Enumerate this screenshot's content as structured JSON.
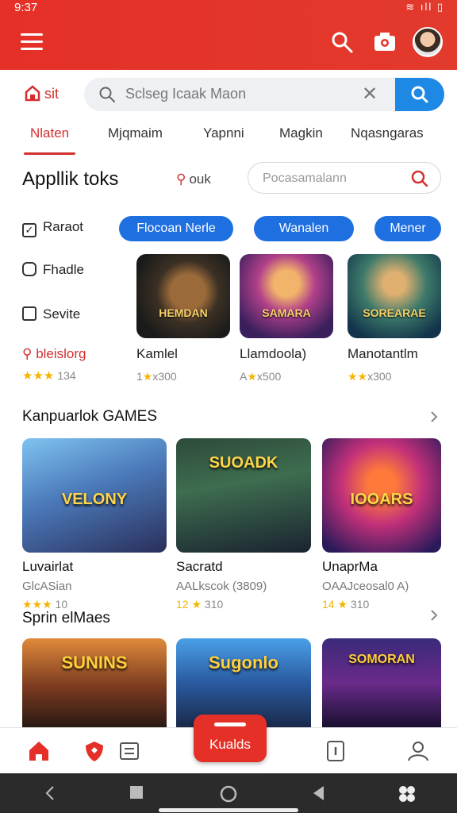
{
  "status": {
    "time": "9:37",
    "icons": "≋ ıll ▯"
  },
  "search": {
    "label": "sit",
    "query": "Sclseg Icaak Maon"
  },
  "tabs": [
    {
      "label": "Nlaten",
      "active": true
    },
    {
      "label": "Mjqmaim",
      "active": false
    },
    {
      "label": "Yapnni",
      "active": false
    },
    {
      "label": "Magkin",
      "active": false
    },
    {
      "label": "Nqasngaras",
      "active": false
    }
  ],
  "section_apps": {
    "title": "Appllik toks",
    "sort_label": "ouk",
    "filter_placeholder": "Pocasamalann"
  },
  "filters": [
    {
      "label": "Raraot",
      "checked": true
    },
    {
      "label": "Fhadle",
      "checked": false
    },
    {
      "label": "Sevite",
      "checked": false
    },
    {
      "label": "bleislorg",
      "rating_stars": "★★★",
      "rating_count": "134"
    }
  ],
  "pills": [
    "Flocoan Nerle",
    "Wanalen",
    "Mener"
  ],
  "apps": [
    {
      "title_art": "HEMDAN",
      "name": "Kamlel",
      "rating_prefix": "1",
      "rating_star": "★",
      "rating_text": "x300"
    },
    {
      "title_art": "SAMARA",
      "name": "Llamdoola)",
      "rating_prefix": "A",
      "rating_star": "★",
      "rating_text": "x500"
    },
    {
      "title_art": "SOREARAE",
      "name": "Manotantlm",
      "rating_prefix": "",
      "rating_star": "★★",
      "rating_text": "x300"
    }
  ],
  "section_games": {
    "title": "Kanpuarlok GAMES"
  },
  "games": [
    {
      "title_art": "VELONY",
      "name": "Luvairlat",
      "sub": "GlcASian",
      "rating_star": "★★★",
      "rating_text": "10"
    },
    {
      "title_art": "SUOADK",
      "name": "Sacratd",
      "sub": "AALkscok (3809)",
      "rating_star": "12 ★",
      "rating_text": "310"
    },
    {
      "title_art": "IOOARS",
      "name": "UnaprMa",
      "sub": "OAAJceosal0 A)",
      "rating_star": "14 ★",
      "rating_text": "310"
    }
  ],
  "section_sprin": {
    "title": "Sprin elMaes"
  },
  "banners": [
    {
      "title_art": "SUNINS"
    },
    {
      "title_art": "Sugonlo"
    },
    {
      "title_art": "SOMORAN"
    }
  ],
  "bottom_nav": {
    "fab_label": "Kualds"
  },
  "colors": {
    "brand_red": "#e53028",
    "accent_blue": "#1e6fe0",
    "star": "#f5b400"
  }
}
